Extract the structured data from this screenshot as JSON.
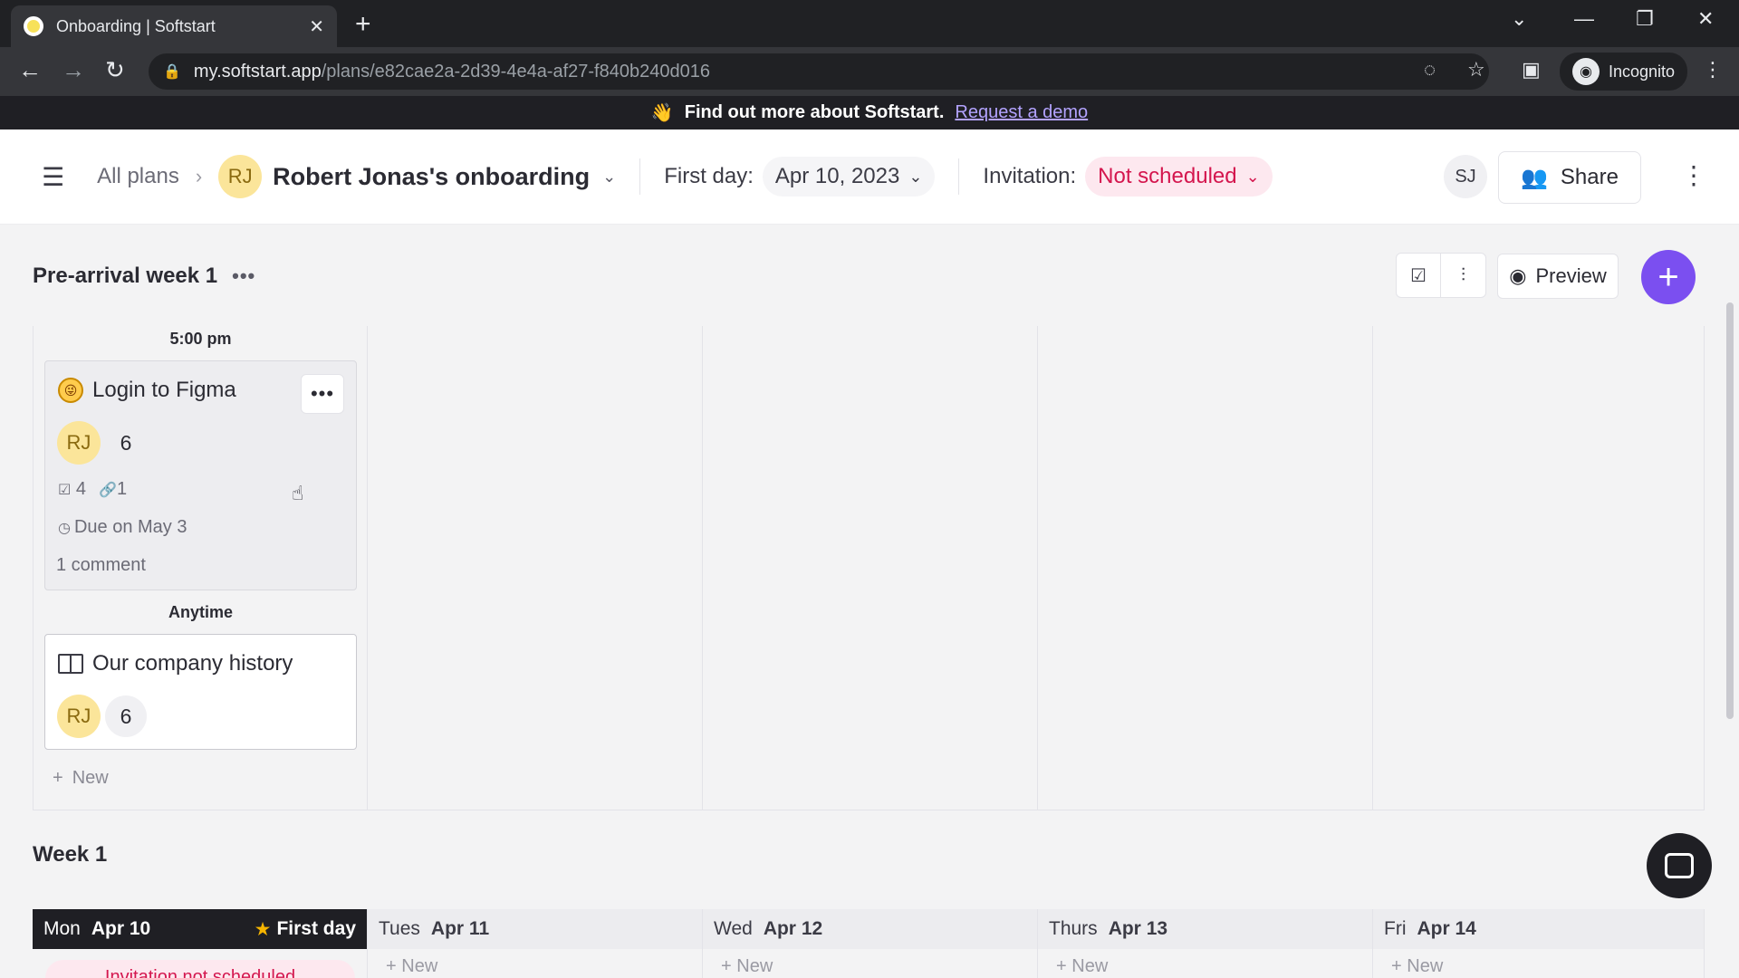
{
  "browser": {
    "tab_title": "Onboarding | Softstart",
    "url_host": "my.softstart.app",
    "url_path": "/plans/e82cae2a-2d39-4e4a-af27-f840b240d016",
    "profile_label": "Incognito"
  },
  "banner": {
    "emoji": "👋",
    "text": "Find out more about Softstart.",
    "link": "Request a demo"
  },
  "header": {
    "breadcrumb_root": "All plans",
    "avatar_initials": "RJ",
    "plan_title": "Robert Jonas's onboarding",
    "first_day_label": "First day:",
    "first_day_value": "Apr 10, 2023",
    "invitation_label": "Invitation:",
    "invitation_value": "Not scheduled",
    "user_initials": "SJ",
    "share_label": "Share"
  },
  "section": {
    "title": "Pre-arrival week 1",
    "preview_label": "Preview"
  },
  "column1": {
    "time_label": "5:00 pm",
    "anytime_label": "Anytime",
    "new_label": "New",
    "cards": [
      {
        "title": "Login to Figma",
        "assignee": "RJ",
        "count": "6",
        "checklist": "4",
        "links": "1",
        "due": "Due on May 3",
        "comments": "1 comment"
      },
      {
        "title": "Our company history",
        "assignee": "RJ",
        "count": "6"
      }
    ]
  },
  "week": {
    "title": "Week 1",
    "days": [
      {
        "dow": "Mon",
        "date": "Apr 10",
        "badge": "First day"
      },
      {
        "dow": "Tues",
        "date": "Apr 11"
      },
      {
        "dow": "Wed",
        "date": "Apr 12"
      },
      {
        "dow": "Thurs",
        "date": "Apr 13"
      },
      {
        "dow": "Fri",
        "date": "Apr 14"
      }
    ],
    "mon_alert": "Invitation not scheduled",
    "new_label": "New"
  },
  "colors": {
    "accent": "#7b4ff0",
    "danger": "#d4164e",
    "avatar_bg": "#fbe59a"
  }
}
